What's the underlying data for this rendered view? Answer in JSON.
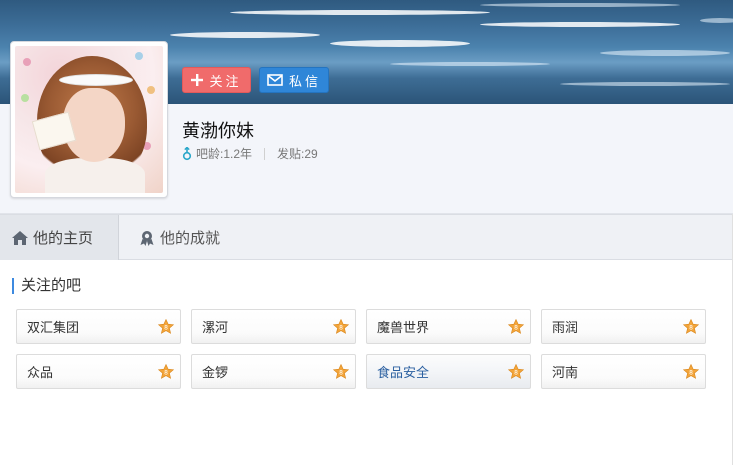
{
  "profile": {
    "username": "黄渤你妹",
    "bar_age": "吧龄:1.2年",
    "post_count": "发贴:29",
    "gender_icon": "male-gender-icon",
    "accent": "#3d8ae0"
  },
  "actions": {
    "follow_label": "关注",
    "message_label": "私信",
    "follow_color": "#f06b6b",
    "message_color": "#2f86d8"
  },
  "tabs": [
    {
      "label": "他的主页",
      "icon": "home-icon",
      "active": true
    },
    {
      "label": "他的成就",
      "icon": "achievement-badge-icon",
      "active": false
    }
  ],
  "followed_bars": {
    "title": "关注的吧",
    "items": [
      {
        "name": "双汇集团",
        "icon": "bar-level-star-icon"
      },
      {
        "name": "漯河",
        "icon": "bar-level-star-icon"
      },
      {
        "name": "魔兽世界",
        "icon": "bar-level-star-icon"
      },
      {
        "name": "雨润",
        "icon": "bar-level-star-icon"
      },
      {
        "name": "众品",
        "icon": "bar-level-star-icon"
      },
      {
        "name": "金锣",
        "icon": "bar-level-star-icon"
      },
      {
        "name": "食品安全",
        "icon": "bar-level-star-icon",
        "hovered": true
      },
      {
        "name": "河南",
        "icon": "bar-level-star-icon"
      }
    ]
  }
}
